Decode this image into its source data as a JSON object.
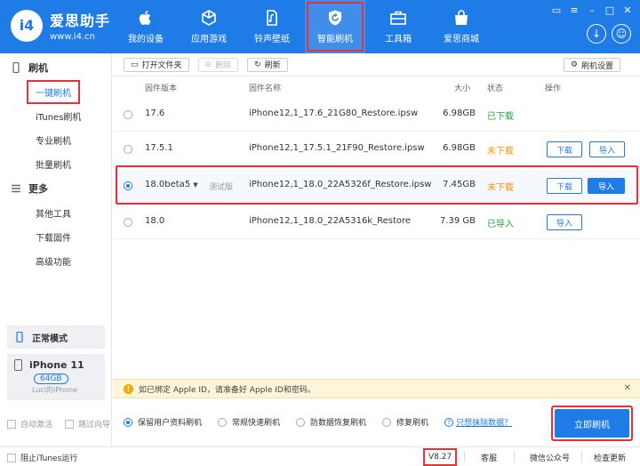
{
  "app": {
    "logo_mark": "i4",
    "title": "爱思助手",
    "url": "www.i4.cn"
  },
  "nav": [
    {
      "label": "我的设备",
      "icon": "apple-icon"
    },
    {
      "label": "应用游戏",
      "icon": "cube-icon"
    },
    {
      "label": "铃声壁纸",
      "icon": "music-file-icon"
    },
    {
      "label": "智能刷机",
      "icon": "refresh-shield-icon"
    },
    {
      "label": "工具箱",
      "icon": "toolbox-icon"
    },
    {
      "label": "爱思商城",
      "icon": "shopping-bag-icon"
    }
  ],
  "sidebar": {
    "flash_section": "刷机",
    "flash_items": [
      "一键刷机",
      "iTunes刷机",
      "专业刷机",
      "批量刷机"
    ],
    "more_section": "更多",
    "more_items": [
      "其他工具",
      "下载固件",
      "高级功能"
    ],
    "mode": "正常模式",
    "device": {
      "name": "iPhone 11",
      "capacity": "64GB",
      "owner": "Luci的iPhone"
    },
    "auto_activate": "自动激活",
    "skip_guide": "跳过向导"
  },
  "toolbar": {
    "open_folder": "打开文件夹",
    "delete": "删除",
    "refresh": "刷新",
    "flash_settings": "刷机设置"
  },
  "table": {
    "headers": {
      "version": "固件版本",
      "name": "固件名称",
      "size": "大小",
      "status": "状态",
      "action": "操作"
    },
    "rows": [
      {
        "version": "17.6",
        "tag": "",
        "name": "iPhone12,1_17.6_21G80_Restore.ipsw",
        "size": "6.98GB",
        "status": "已下载",
        "status_color": "#23a33a",
        "download": "",
        "import": ""
      },
      {
        "version": "17.5.1",
        "tag": "",
        "name": "iPhone12,1_17.5.1_21F90_Restore.ipsw",
        "size": "6.98GB",
        "status": "未下载",
        "status_color": "#f39800",
        "download": "下载",
        "import": "导入"
      },
      {
        "version": "18.0beta5",
        "tag": "测试版",
        "name": "iPhone12,1_18.0_22A5326f_Restore.ipsw",
        "size": "7.45GB",
        "status": "未下载",
        "status_color": "#f39800",
        "download": "下载",
        "import": "导入"
      },
      {
        "version": "18.0",
        "tag": "",
        "name": "iPhone12,1_18.0_22A5316k_Restore",
        "size": "7.39 GB",
        "status": "已导入",
        "status_color": "#23a33a",
        "download": "",
        "import": "导入"
      }
    ]
  },
  "alert": {
    "text": "如已绑定 Apple ID，请准备好 Apple ID和密码。"
  },
  "options": {
    "keep_data": "保留用户资料刷机",
    "quick": "常规快速刷机",
    "anti_recovery": "防数据恢复刷机",
    "repair": "修复刷机",
    "erase_link": "只想抹除数据？",
    "flash_now": "立即刷机"
  },
  "statusbar": {
    "block_itunes": "阻止iTunes运行",
    "version": "V8.27",
    "service": "客服",
    "wechat": "微信公众号",
    "update": "检查更新"
  },
  "colors": {
    "brand": "#1f7be6",
    "highlight": "#e2323b",
    "green": "#23a33a",
    "orange": "#f39800"
  }
}
